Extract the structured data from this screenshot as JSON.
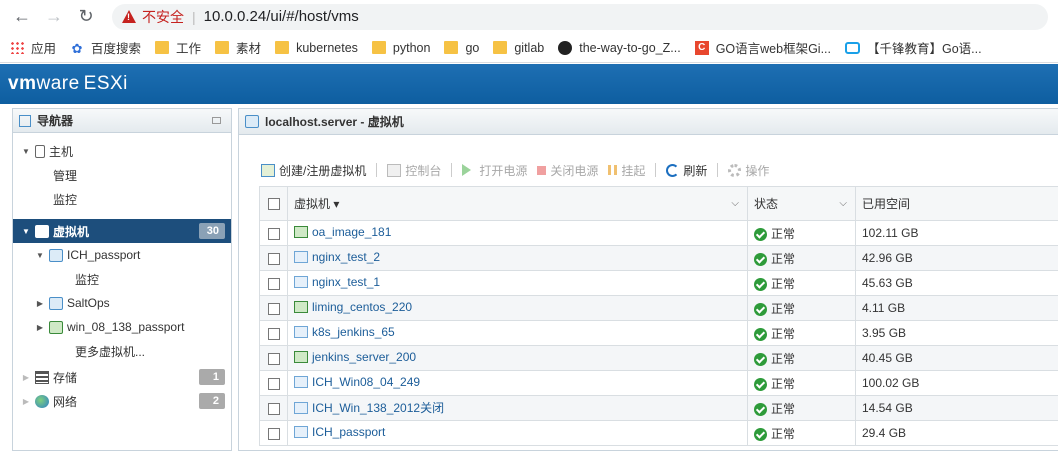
{
  "browser": {
    "insecure_label": "不安全",
    "url": "10.0.0.24/ui/#/host/vms"
  },
  "bookmarks": [
    {
      "label": "应用",
      "icon": "apps-icon"
    },
    {
      "label": "百度搜索",
      "icon": "paw-icon"
    },
    {
      "label": "工作",
      "icon": "folder-icon"
    },
    {
      "label": "素材",
      "icon": "folder-icon"
    },
    {
      "label": "kubernetes",
      "icon": "folder-icon"
    },
    {
      "label": "python",
      "icon": "folder-icon"
    },
    {
      "label": "go",
      "icon": "folder-icon"
    },
    {
      "label": "gitlab",
      "icon": "folder-icon"
    },
    {
      "label": "the-way-to-go_Z...",
      "icon": "github-icon"
    },
    {
      "label": "GO语言web框架Gi...",
      "icon": "csdn-icon"
    },
    {
      "label": "【千锋教育】Go语...",
      "icon": "bilibili-icon"
    }
  ],
  "header": {
    "brand_vm": "vm",
    "brand_ware": "ware",
    "product": "ESXi"
  },
  "navigator": {
    "title": "导航器",
    "host_label": "主机",
    "manage_label": "管理",
    "monitor_label": "监控",
    "vms_label": "虚拟机",
    "vms_count": "30",
    "vm1_label": "ICH_passport",
    "vm1_monitor": "监控",
    "vm2_label": "SaltOps",
    "vm3_label": "win_08_138_passport",
    "more_vms": "更多虚拟机...",
    "storage_label": "存储",
    "storage_count": "1",
    "network_label": "网络",
    "network_count": "2"
  },
  "main": {
    "title": "localhost.server - 虚拟机",
    "toolbar": {
      "create": "创建/注册虚拟机",
      "console": "控制台",
      "power_on": "打开电源",
      "power_off": "关闭电源",
      "suspend": "挂起",
      "refresh": "刷新",
      "actions": "操作"
    },
    "columns": {
      "name": "虚拟机 ▾",
      "state": "状态",
      "used": "已用空间"
    },
    "rows": [
      {
        "name": "oa_image_181",
        "state": "正常",
        "used": "102.11 GB",
        "power": "on"
      },
      {
        "name": "nginx_test_2",
        "state": "正常",
        "used": "42.96 GB",
        "power": "off"
      },
      {
        "name": "nginx_test_1",
        "state": "正常",
        "used": "45.63 GB",
        "power": "off"
      },
      {
        "name": "liming_centos_220",
        "state": "正常",
        "used": "4.11 GB",
        "power": "on"
      },
      {
        "name": "k8s_jenkins_65",
        "state": "正常",
        "used": "3.95 GB",
        "power": "off"
      },
      {
        "name": "jenkins_server_200",
        "state": "正常",
        "used": "40.45 GB",
        "power": "on"
      },
      {
        "name": "ICH_Win08_04_249",
        "state": "正常",
        "used": "100.02 GB",
        "power": "off"
      },
      {
        "name": "ICH_Win_138_2012关闭",
        "state": "正常",
        "used": "14.54 GB",
        "power": "off"
      },
      {
        "name": "ICH_passport",
        "state": "正常",
        "used": "29.4 GB",
        "power": "off"
      }
    ]
  }
}
